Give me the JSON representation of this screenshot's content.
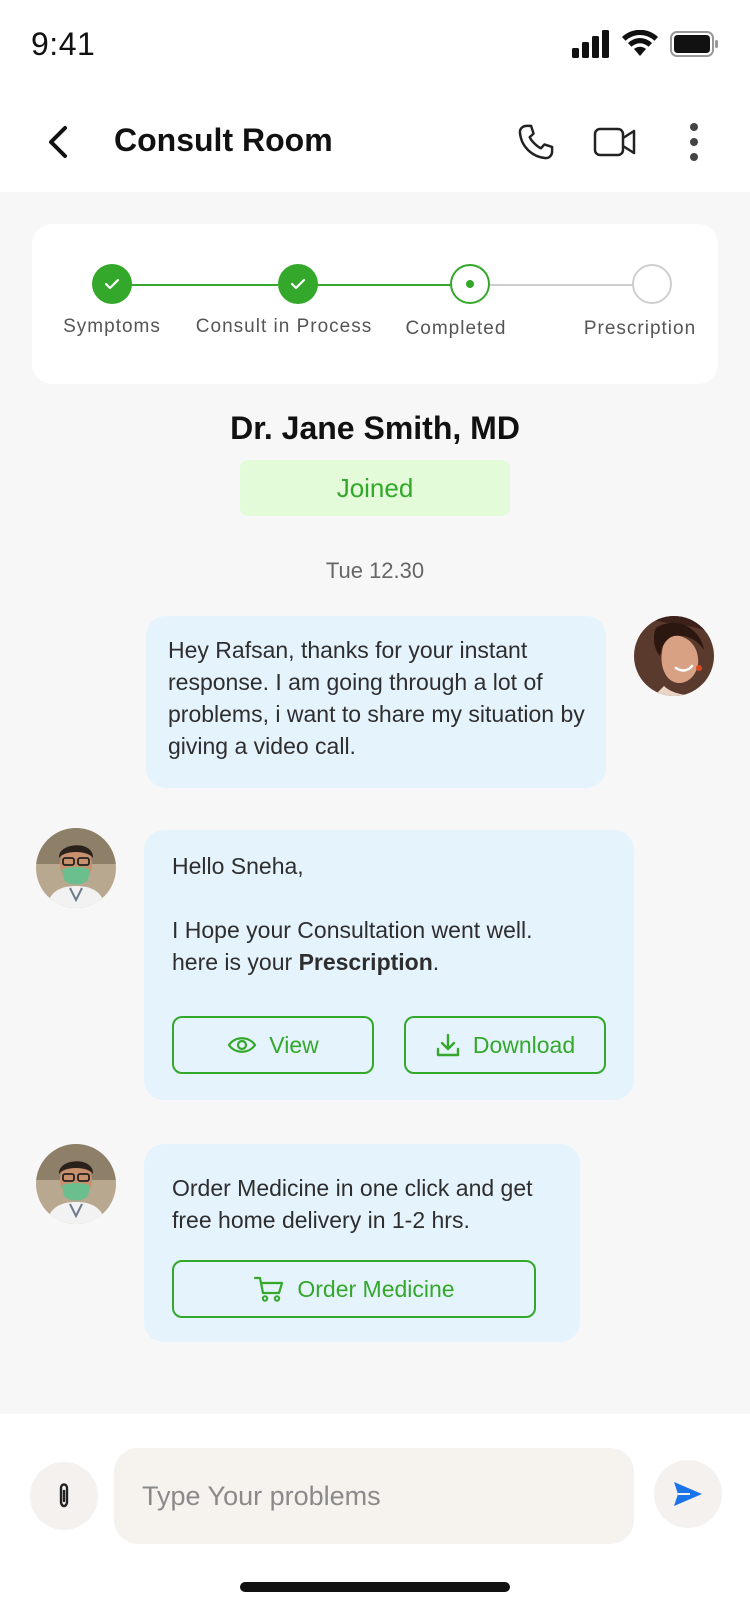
{
  "status_bar": {
    "time": "9:41"
  },
  "header": {
    "title": "Consult Room",
    "icons": [
      "back-arrow-icon",
      "phone-icon",
      "video-camera-icon",
      "more-vertical-icon"
    ]
  },
  "stepper": {
    "steps": [
      {
        "label": "Symptoms",
        "state": "done"
      },
      {
        "label": "Consult in Process",
        "state": "done"
      },
      {
        "label": "Completed",
        "state": "current"
      },
      {
        "label": "Prescription",
        "state": "todo"
      }
    ],
    "accent": "#34a82a"
  },
  "doctor": {
    "name": "Dr. Jane Smith, MD",
    "status": "Joined"
  },
  "chat": {
    "date": "Tue 12.30",
    "messages": [
      {
        "sender": "patient",
        "text": "Hey Rafsan, thanks for your instant response. I am going through a lot of problems, i want to share my situation by giving a video call."
      },
      {
        "sender": "doctor",
        "greeting": "Hello Sneha,",
        "line1": "I Hope your Consultation went well.",
        "line2_prefix": "here is your ",
        "line2_bold": "Prescription",
        "line2_suffix": ".",
        "view_label": "View",
        "download_label": "Download"
      },
      {
        "sender": "doctor",
        "text": "Order Medicine in one click and get free home delivery in 1-2 hrs.",
        "order_label": "Order Medicine"
      }
    ]
  },
  "composer": {
    "placeholder": "Type Your problems"
  },
  "colors": {
    "accent_green": "#34a82a",
    "bubble_bg": "#e5f3fd",
    "send_blue": "#1a73e8"
  }
}
